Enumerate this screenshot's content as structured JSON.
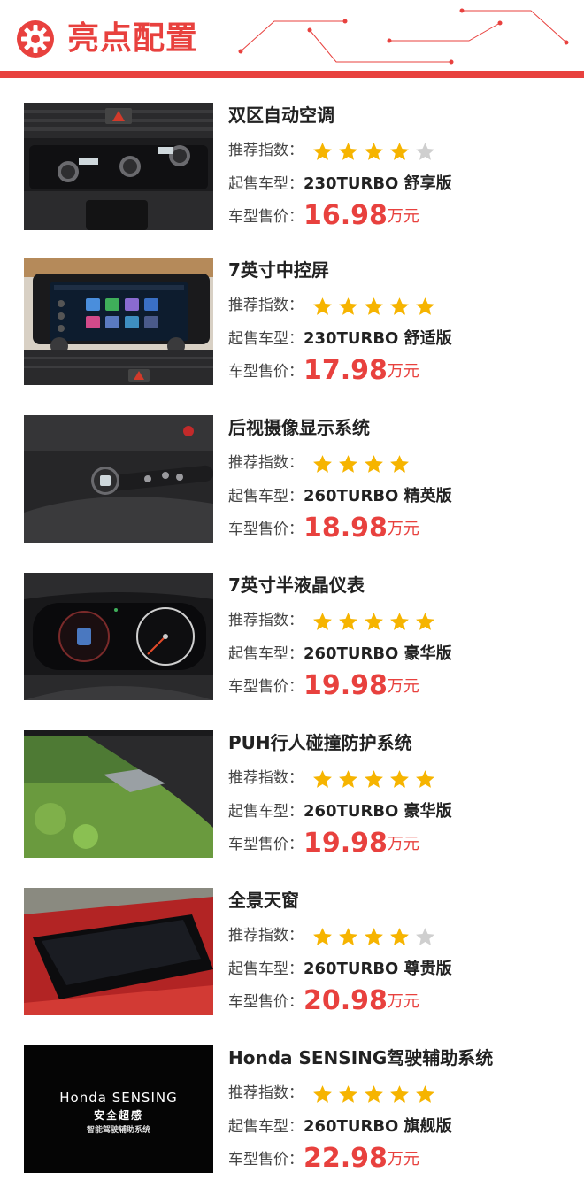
{
  "header": {
    "title": "亮点配置",
    "accent_color": "#e8413e",
    "icon": "gear-icon"
  },
  "labels": {
    "rating": "推荐指数",
    "model": "起售车型",
    "price": "车型售价",
    "colon": "："
  },
  "items": [
    {
      "name": "双区自动空调",
      "rating": 4,
      "max_rating": 5,
      "model": "230TURBO 舒享版",
      "price": "16.98",
      "unit": "万元",
      "image": "dual-zone-climate-control-photo"
    },
    {
      "name": "7英寸中控屏",
      "rating": 5,
      "max_rating": 5,
      "model": "230TURBO 舒适版",
      "price": "17.98",
      "unit": "万元",
      "image": "center-touchscreen-photo"
    },
    {
      "name": "后视摄像显示系统",
      "rating": 4,
      "max_rating": 4,
      "model": "260TURBO 精英版",
      "price": "18.98",
      "unit": "万元",
      "image": "lanewatch-camera-stalk-photo"
    },
    {
      "name": "7英寸半液晶仪表",
      "rating": 5,
      "max_rating": 5,
      "model": "260TURBO 豪华版",
      "price": "19.98",
      "unit": "万元",
      "image": "instrument-cluster-photo"
    },
    {
      "name": "PUH行人碰撞防护系统",
      "rating": 5,
      "max_rating": 5,
      "model": "260TURBO 豪华版",
      "price": "19.98",
      "unit": "万元",
      "image": "pedestrian-protection-hood-photo"
    },
    {
      "name": "全景天窗",
      "rating": 4,
      "max_rating": 5,
      "model": "260TURBO 尊贵版",
      "price": "20.98",
      "unit": "万元",
      "image": "panoramic-sunroof-photo"
    },
    {
      "name": "Honda SENSING驾驶辅助系统",
      "rating": 5,
      "max_rating": 5,
      "model": "260TURBO 旗舰版",
      "price": "22.98",
      "unit": "万元",
      "image": "honda-sensing-photo",
      "image_text": {
        "brand": "Honda SENSING",
        "line1": "安全超感",
        "line2": "智能驾驶辅助系统"
      }
    }
  ]
}
